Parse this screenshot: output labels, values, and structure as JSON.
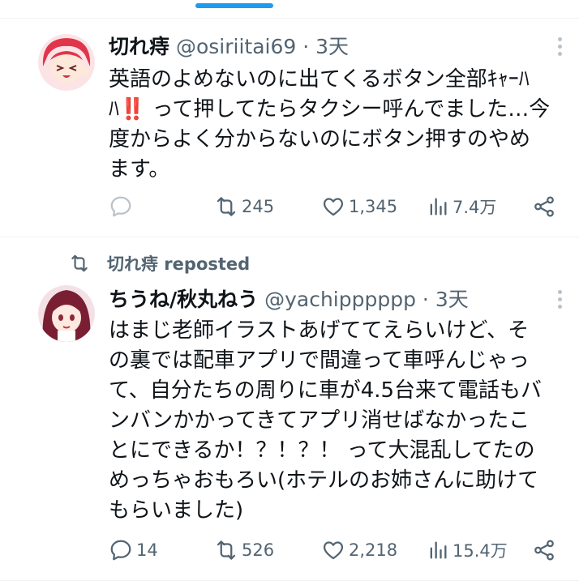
{
  "tweets": [
    {
      "name": "切れ痔",
      "handle": "@osiriitai69",
      "sep": "·",
      "time": "3天",
      "lines": [
        "英語のよめないのに出てくるボタン全部ｷｬｰﾊ",
        "ﾊ‼️ って押してたらタクシー呼んでました…今",
        "度からよく分からないのにボタン押すのやめ",
        "ます。"
      ],
      "reply_count": "",
      "retweet_count": "245",
      "like_count": "1,345",
      "view_count": "7.4万"
    },
    {
      "name": "ちうね/秋丸ねう",
      "handle": "@yachipppppp",
      "sep": "·",
      "time": "3天",
      "lines": [
        "はまじ老師イラストあげててえらいけど、そ",
        "の裏では配車アプリで間違って車呼んじゃっ",
        "て、自分たちの周りに車が4.5台来て電話もバ",
        "ンバンかかってきてアプリ消せばなかったこ",
        "とにできるか！？！？！ って大混乱してたの",
        "めっちゃおもろい(ホテルのお姉さんに助けて",
        "もらいました)"
      ],
      "reply_count": "14",
      "retweet_count": "526",
      "like_count": "2,218",
      "view_count": "15.4万"
    }
  ],
  "repost_label": "切れ痔 reposted",
  "colors": {
    "accent": "#1d9bf0",
    "secondary_text": "#536471",
    "text": "#0f1419"
  },
  "icons": [
    "more-icon",
    "reply-icon",
    "retweet-icon",
    "like-icon",
    "views-icon",
    "share-icon"
  ]
}
